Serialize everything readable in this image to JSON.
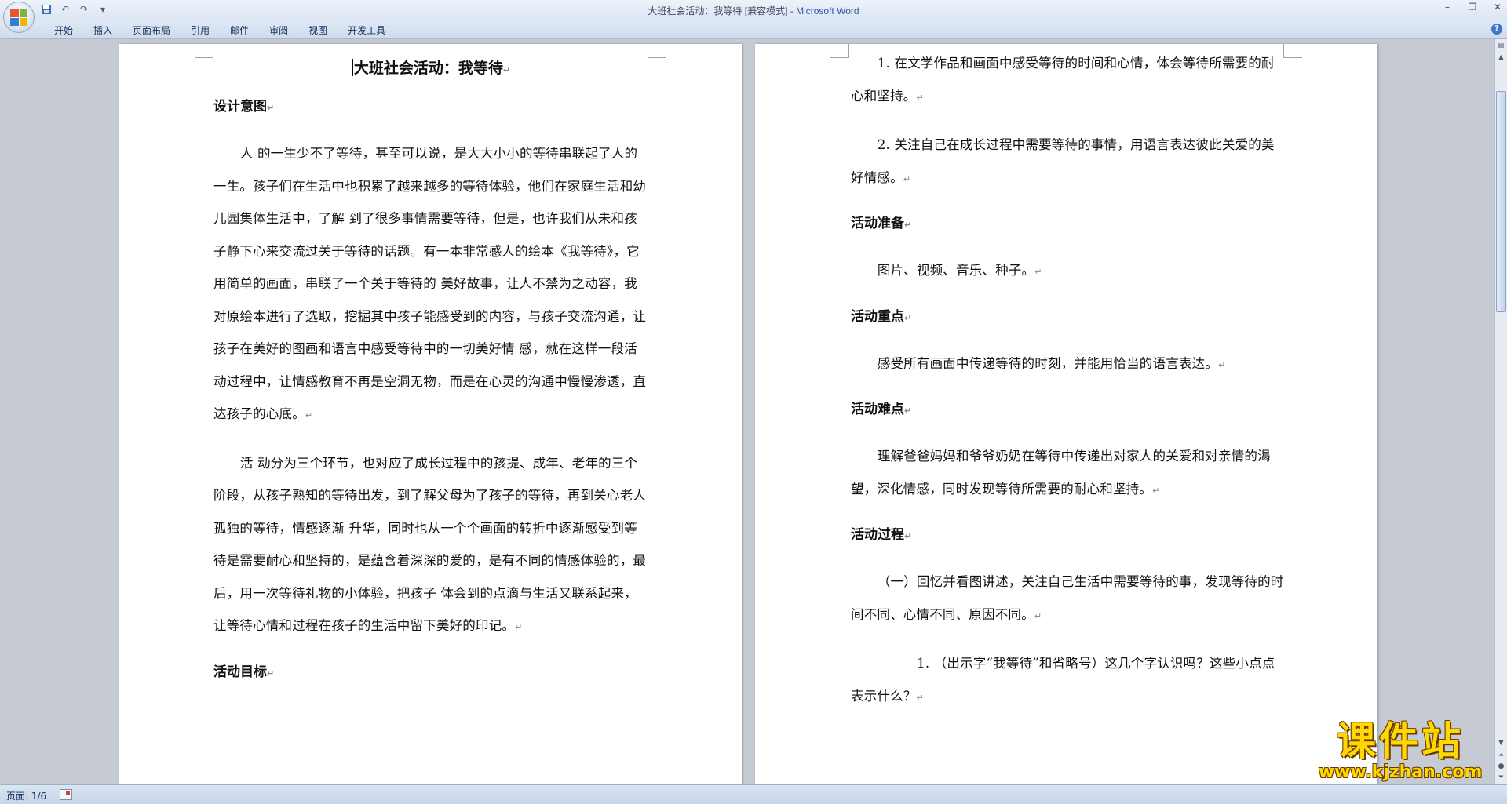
{
  "window": {
    "title": "大班社会活动：我等待 [兼容模式] - ",
    "app_name": "Microsoft Word"
  },
  "quick_access": {
    "icons": [
      "save-icon",
      "undo-icon",
      "redo-icon",
      "customize-icon"
    ]
  },
  "ribbon": {
    "tabs": [
      "开始",
      "插入",
      "页面布局",
      "引用",
      "邮件",
      "审阅",
      "视图",
      "开发工具"
    ]
  },
  "document": {
    "title": "大班社会活动：我等待",
    "pilcrow": "↵",
    "left_page": {
      "heading_design": "设计意图",
      "para_1": "人 的一生少不了等待，甚至可以说，是大大小小的等待串联起了人的一生。孩子们在生活中也积累了越来越多的等待体验，他们在家庭生活和幼儿园集体生活中，了解 到了很多事情需要等待，但是，也许我们从未和孩子静下心来交流过关于等待的话题。有一本非常感人的绘本《我等待》，它用简单的画面，串联了一个关于等待的 美好故事，让人不禁为之动容，我对原绘本进行了选取，挖掘其中孩子能感受到的内容，与孩子交流沟通，让孩子在美好的图画和语言中感受等待中的一切美好情 感，就在这样一段活动过程中，让情感教育不再是空洞无物，而是在心灵的沟通中慢慢渗透，直达孩子的心底。",
      "para_2": "活 动分为三个环节，也对应了成长过程中的孩提、成年、老年的三个阶段，从孩子熟知的等待出发，到了解父母为了孩子的等待，再到关心老人孤独的等待，情感逐渐 升华，同时也从一个个画面的转折中逐渐感受到等待是需要耐心和坚持的，是蕴含着深深的爱的，是有不同的情感体验的，最后，用一次等待礼物的小体验，把孩子 体会到的点滴与生活又联系起来，让等待心情和过程在孩子的生活中留下美好的印记。",
      "heading_goal": "活动目标"
    },
    "right_page": {
      "goal_1": "1. 在文学作品和画面中感受等待的时间和心情，体会等待所需要的耐心和坚持。",
      "goal_2": "2. 关注自己在成长过程中需要等待的事情，用语言表达彼此关爱的美好情感。",
      "heading_prep": "活动准备",
      "prep_text": "图片、视频、音乐、种子。",
      "heading_key": "活动重点",
      "key_text": "感受所有画面中传递等待的时刻，并能用恰当的语言表达。",
      "heading_difficult": "活动难点",
      "difficult_text": "理解爸爸妈妈和爷爷奶奶在等待中传递出对家人的关爱和对亲情的渴望，深化情感，同时发现等待所需要的耐心和坚持。",
      "heading_process": "活动过程",
      "process_1": "（一）回忆并看图讲述，关注自己生活中需要等待的事，发现等待的时间不同、心情不同、原因不同。",
      "process_1_1": "1. （出示字“我等待”和省略号）这几个字认识吗？这些小点点表示什么？"
    }
  },
  "statusbar": {
    "page_info": "页面: 1/6"
  },
  "watermark": {
    "main": "课件站",
    "sub": "www.kjzhan.com"
  }
}
